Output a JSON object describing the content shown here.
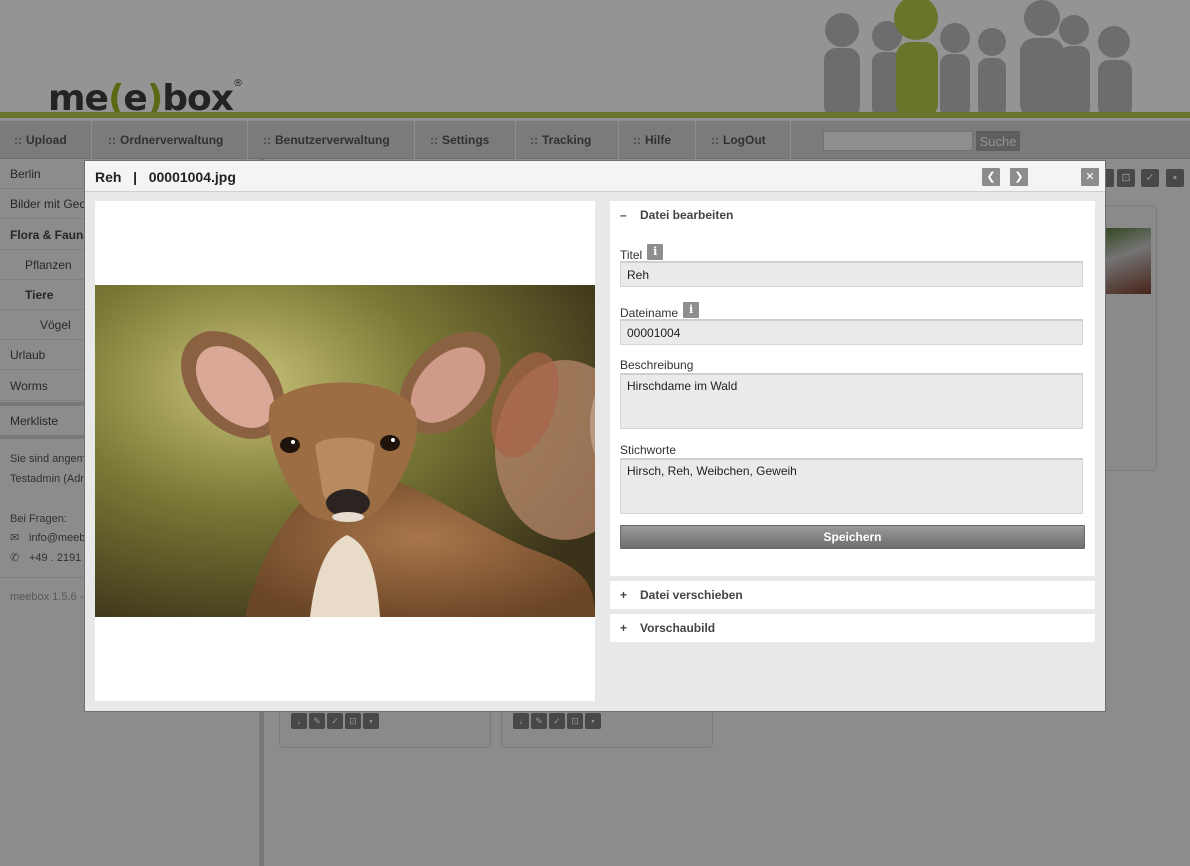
{
  "brand": {
    "logo_pre": "me",
    "logo_bracket_open": "(",
    "logo_mid": "e",
    "logo_bracket_close": ")",
    "logo_post": "box",
    "logo_reg": "®",
    "accent": "#9fb322"
  },
  "nav": {
    "items": [
      {
        "label": "Upload"
      },
      {
        "label": "Ordnerverwaltung"
      },
      {
        "label": "Benutzerverwaltung"
      },
      {
        "label": "Settings"
      },
      {
        "label": "Tracking"
      },
      {
        "label": "Hilfe"
      },
      {
        "label": "LogOut"
      }
    ],
    "prefix": "::",
    "search_value": "",
    "search_button": "Suche"
  },
  "sidebar": {
    "items": [
      {
        "label": "Berlin"
      },
      {
        "label": "Bilder mit Geo"
      },
      {
        "label": "Flora & Fauna"
      },
      {
        "label": "Pflanzen"
      },
      {
        "label": "Tiere"
      },
      {
        "label": "Vögel"
      },
      {
        "label": "Urlaub"
      },
      {
        "label": "Worms"
      }
    ],
    "merkliste": "Merkliste",
    "logged_in_1": "Sie sind angem",
    "logged_in_2": "Testadmin (Adr",
    "questions": "Bei Fragen:",
    "email": "info@meeb",
    "phone": "+49 . 2191",
    "version": "meebox 1.5.6 -"
  },
  "modal": {
    "title": "Reh",
    "separator": "|",
    "filename": "00001004.jpg",
    "prev_icon": "chevron-left-icon",
    "next_icon": "chevron-right-icon",
    "close_icon": "close-icon"
  },
  "edit_panel": {
    "header": "Datei bearbeiten",
    "expanded_sign": "–",
    "collapsed_sign": "+",
    "info_glyph": "i",
    "fields": {
      "titel_label": "Titel",
      "titel_value": "Reh",
      "dateiname_label": "Dateiname",
      "dateiname_value": "00001004",
      "beschreibung_label": "Beschreibung",
      "beschreibung_value": "Hirschdame im Wald",
      "stichworte_label": "Stichworte",
      "stichworte_value": "Hirsch, Reh, Weibchen, Geweih"
    },
    "save_button": "Speichern"
  },
  "move_panel": {
    "header": "Datei verschieben"
  },
  "preview_panel": {
    "header": "Vorschaubild"
  }
}
